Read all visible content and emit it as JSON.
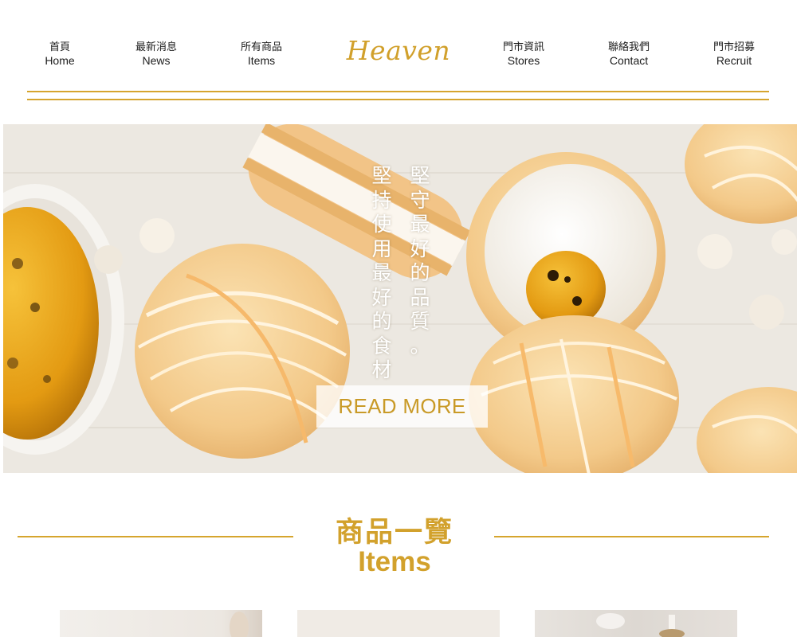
{
  "nav": {
    "items": [
      {
        "zh": "首頁",
        "en": "Home"
      },
      {
        "zh": "最新消息",
        "en": "News"
      },
      {
        "zh": "所有商品",
        "en": "Items"
      },
      {
        "zh": "門市資訊",
        "en": "Stores"
      },
      {
        "zh": "聯絡我們",
        "en": "Contact"
      },
      {
        "zh": "門市招募",
        "en": "Recruit"
      }
    ],
    "logo": "Heaven"
  },
  "hero": {
    "slogan_col1": [
      "堅",
      "守",
      "最",
      "好",
      "的",
      "品",
      "質",
      "。"
    ],
    "slogan_col2": [
      "堅",
      "持",
      "使",
      "用",
      "最",
      "好",
      "的",
      "食",
      "材"
    ],
    "button_label": "READ MORE"
  },
  "section": {
    "title_zh": "商品一覽",
    "title_en": "Items"
  },
  "colors": {
    "accent": "#d6a52e",
    "text": "#1c1c1c",
    "macaron": "#f5cf8e",
    "passionfruit": "#e9a817"
  }
}
